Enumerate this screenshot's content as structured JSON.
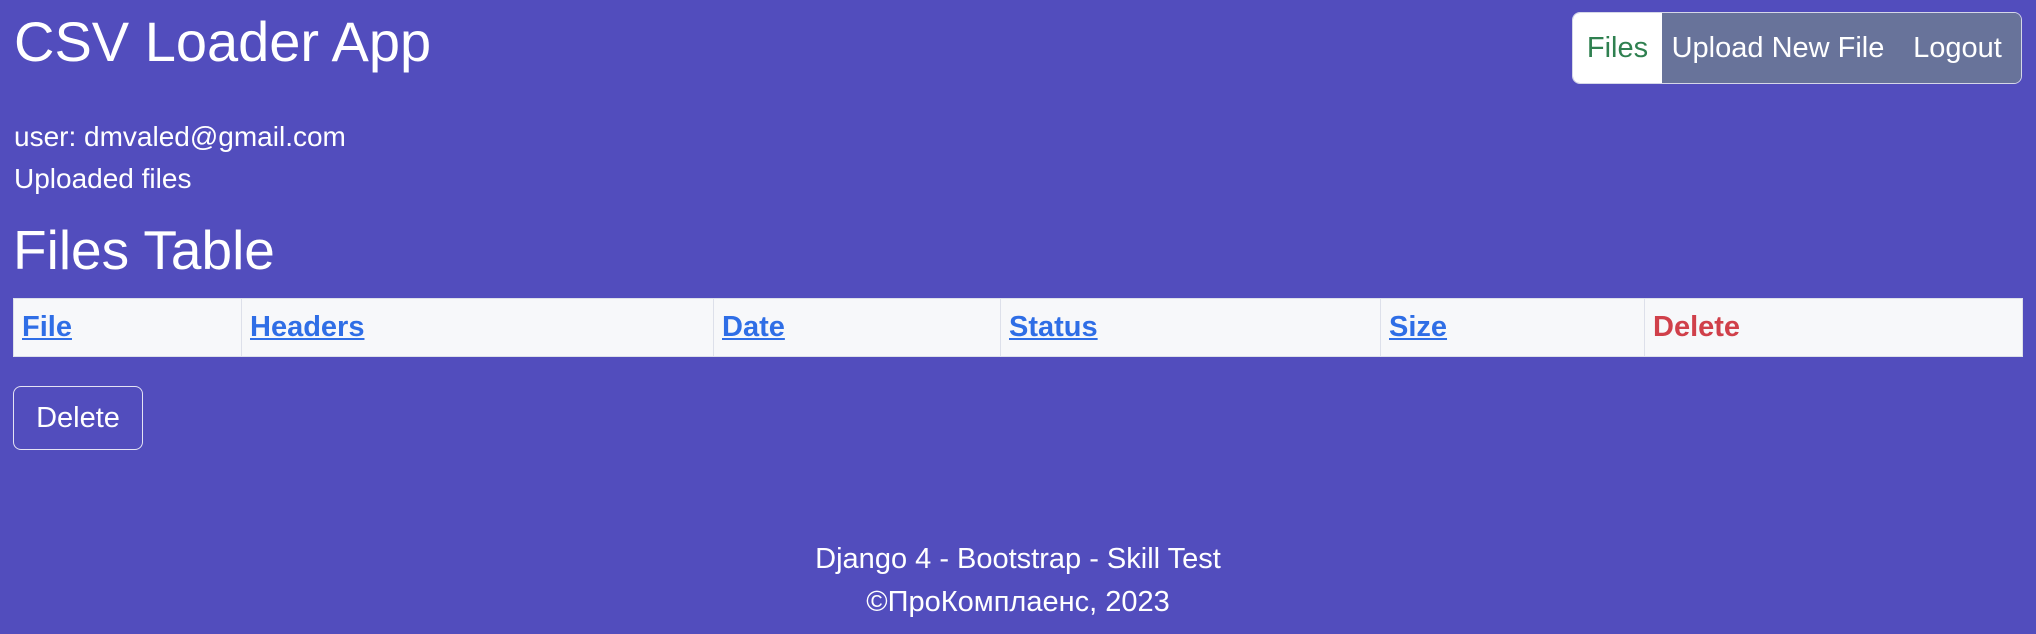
{
  "app": {
    "title": "CSV Loader App"
  },
  "nav": {
    "items": [
      {
        "label": "Files",
        "active": true
      },
      {
        "label": "Upload New File",
        "active": false
      },
      {
        "label": "Logout",
        "active": false
      }
    ]
  },
  "user": {
    "line": "user: dmvaled@gmail.com"
  },
  "section": {
    "subtitle": "Uploaded files",
    "table_title": "Files Table"
  },
  "table": {
    "columns": [
      "File",
      "Headers",
      "Date",
      "Status",
      "Size",
      "Delete"
    ],
    "rows": []
  },
  "actions": {
    "delete_label": "Delete"
  },
  "footer": {
    "line1": "Django 4 - Bootstrap - Skill Test",
    "line2": "©ПроКомплаенс, 2023"
  },
  "colors": {
    "background": "#524dbd",
    "nav_active_text": "#2f8050",
    "nav_inactive_bg": "#68739a",
    "link": "#2f6ee6",
    "danger": "#d0404a",
    "table_header_bg": "#f7f8fa"
  }
}
